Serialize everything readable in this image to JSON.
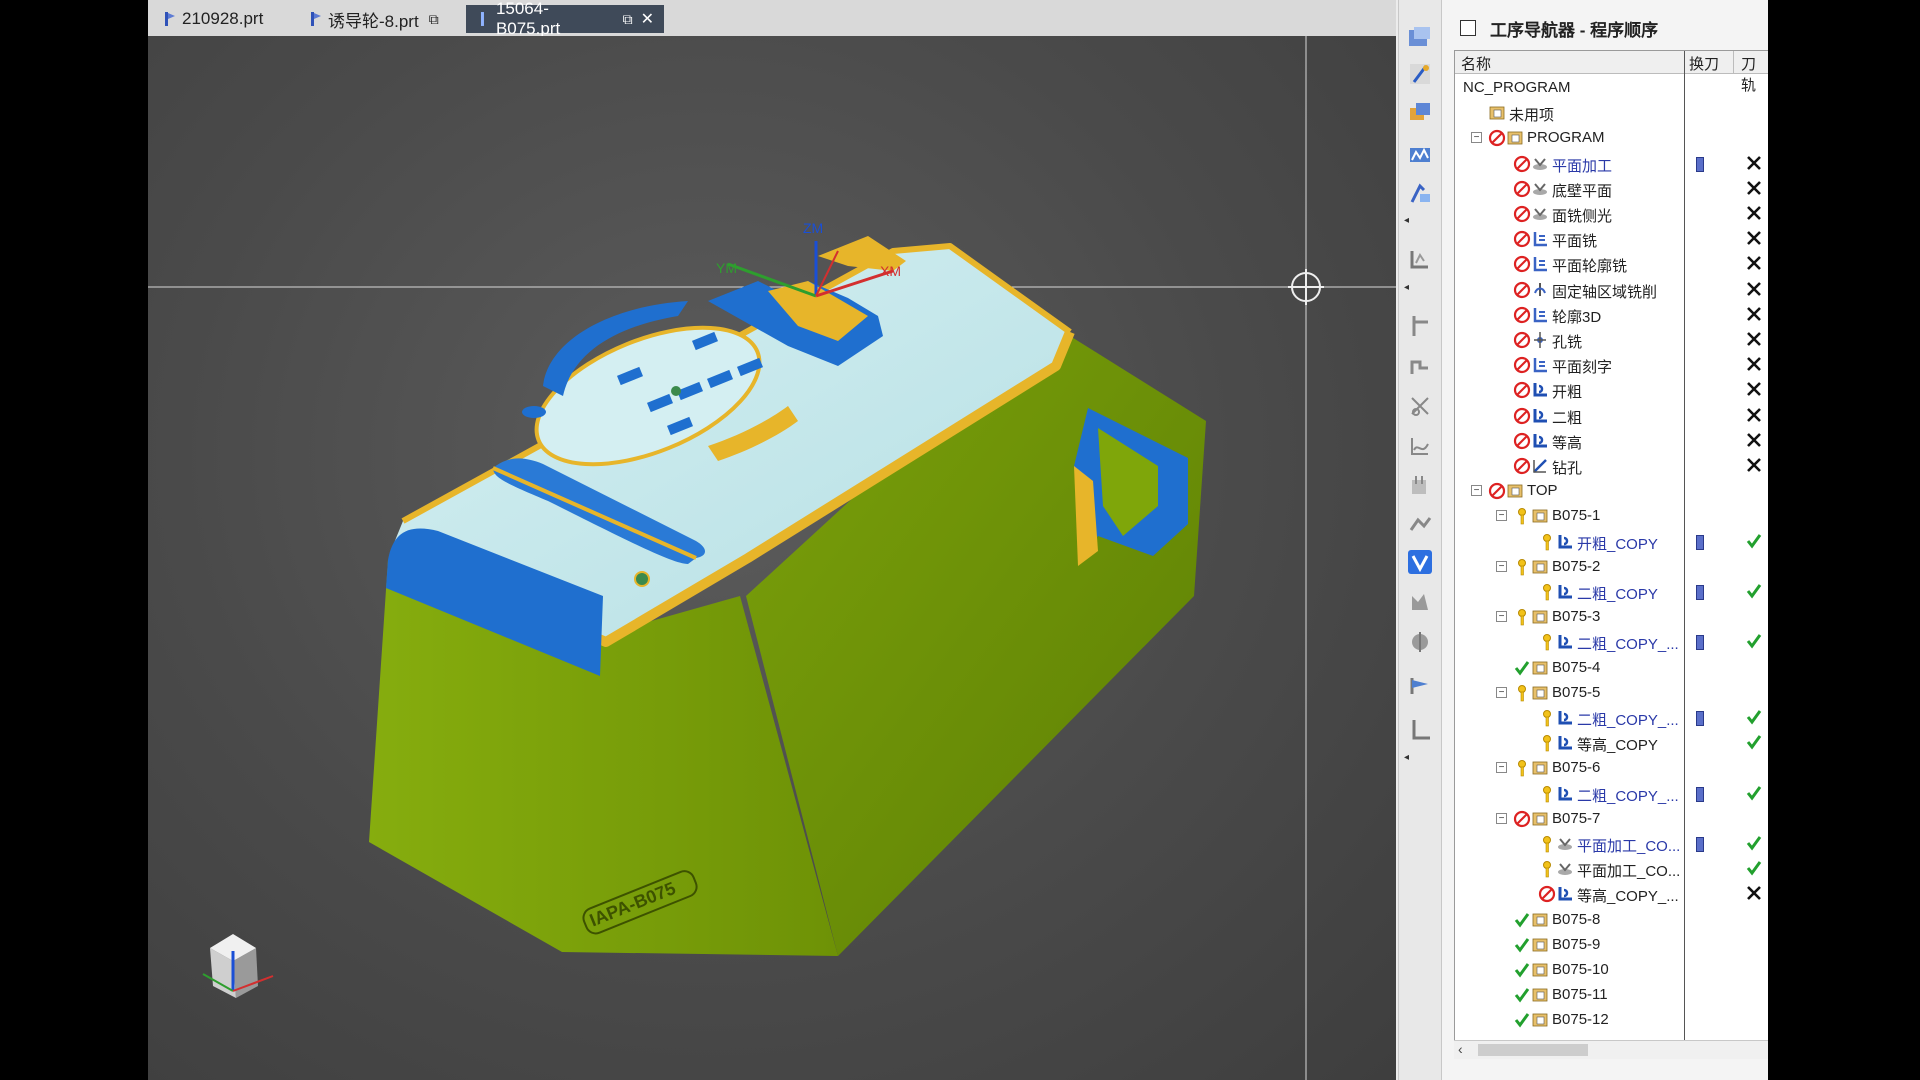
{
  "tabs": [
    {
      "label": "210928.prt",
      "active": false
    },
    {
      "label": "诱导轮-8.prt",
      "active": false
    },
    {
      "label": "15064-B075.prt",
      "active": true
    }
  ],
  "viewport": {
    "axis_labels": {
      "zm": "ZM",
      "ym": "YM",
      "xm": "XM"
    },
    "part_engraving": "IAPA-B075",
    "colors": {
      "body": "#7fa60a",
      "top_face": "#c6e7ea",
      "blend": "#e7b52a",
      "pocket": "#1f6fcf",
      "background": "#4a4a4a"
    }
  },
  "navigator": {
    "title": "工序导航器 - 程序顺序",
    "columns": {
      "name": "名称",
      "tool_change": "换刀",
      "tool_path": "刀轨"
    },
    "rows": [
      {
        "indent": 0,
        "expander": "",
        "status_icon": "",
        "type_icon": "",
        "label": "NC_PROGRAM",
        "blue": false,
        "tool_change": false,
        "path": ""
      },
      {
        "indent": 1,
        "expander": "",
        "status_icon": "",
        "type_icon": "folder",
        "label": "未用项",
        "blue": false,
        "tool_change": false,
        "path": ""
      },
      {
        "indent": 1,
        "expander": "−",
        "status_icon": "ban",
        "type_icon": "folder",
        "label": "PROGRAM",
        "blue": false,
        "tool_change": false,
        "path": ""
      },
      {
        "indent": 2,
        "expander": "",
        "status_icon": "ban",
        "type_icon": "face-mill",
        "label": "平面加工",
        "blue": true,
        "tool_change": true,
        "path": "cross"
      },
      {
        "indent": 2,
        "expander": "",
        "status_icon": "ban",
        "type_icon": "face-mill",
        "label": "底壁平面",
        "blue": false,
        "tool_change": false,
        "path": "cross"
      },
      {
        "indent": 2,
        "expander": "",
        "status_icon": "ban",
        "type_icon": "face-mill",
        "label": "面铣侧光",
        "blue": false,
        "tool_change": false,
        "path": "cross"
      },
      {
        "indent": 2,
        "expander": "",
        "status_icon": "ban",
        "type_icon": "planar",
        "label": "平面铣",
        "blue": false,
        "tool_change": false,
        "path": "cross"
      },
      {
        "indent": 2,
        "expander": "",
        "status_icon": "ban",
        "type_icon": "planar",
        "label": "平面轮廓铣",
        "blue": false,
        "tool_change": false,
        "path": "cross"
      },
      {
        "indent": 2,
        "expander": "",
        "status_icon": "ban",
        "type_icon": "fixed-axis",
        "label": "固定轴区域铣削",
        "blue": false,
        "tool_change": false,
        "path": "cross"
      },
      {
        "indent": 2,
        "expander": "",
        "status_icon": "ban",
        "type_icon": "planar",
        "label": "轮廓3D",
        "blue": false,
        "tool_change": false,
        "path": "cross"
      },
      {
        "indent": 2,
        "expander": "",
        "status_icon": "ban",
        "type_icon": "hole",
        "label": "孔铣",
        "blue": false,
        "tool_change": false,
        "path": "cross"
      },
      {
        "indent": 2,
        "expander": "",
        "status_icon": "ban",
        "type_icon": "planar",
        "label": "平面刻字",
        "blue": false,
        "tool_change": false,
        "path": "cross"
      },
      {
        "indent": 2,
        "expander": "",
        "status_icon": "ban",
        "type_icon": "cavity",
        "label": "开粗",
        "blue": false,
        "tool_change": false,
        "path": "cross"
      },
      {
        "indent": 2,
        "expander": "",
        "status_icon": "ban",
        "type_icon": "cavity",
        "label": "二粗",
        "blue": false,
        "tool_change": false,
        "path": "cross"
      },
      {
        "indent": 2,
        "expander": "",
        "status_icon": "ban",
        "type_icon": "cavity",
        "label": "等高",
        "blue": false,
        "tool_change": false,
        "path": "cross"
      },
      {
        "indent": 2,
        "expander": "",
        "status_icon": "ban",
        "type_icon": "drill",
        "label": "钻孔",
        "blue": false,
        "tool_change": false,
        "path": "cross"
      },
      {
        "indent": 1,
        "expander": "−",
        "status_icon": "ban",
        "type_icon": "folder",
        "label": "TOP",
        "blue": false,
        "tool_change": false,
        "path": ""
      },
      {
        "indent": 2,
        "expander": "−",
        "status_icon": "key",
        "type_icon": "folder",
        "label": "B075-1",
        "blue": false,
        "tool_change": false,
        "path": ""
      },
      {
        "indent": 3,
        "expander": "",
        "status_icon": "key",
        "type_icon": "cavity",
        "label": "开粗_COPY",
        "blue": true,
        "tool_change": true,
        "path": "check"
      },
      {
        "indent": 2,
        "expander": "−",
        "status_icon": "key",
        "type_icon": "folder",
        "label": "B075-2",
        "blue": false,
        "tool_change": false,
        "path": ""
      },
      {
        "indent": 3,
        "expander": "",
        "status_icon": "key",
        "type_icon": "cavity",
        "label": "二粗_COPY",
        "blue": true,
        "tool_change": true,
        "path": "check"
      },
      {
        "indent": 2,
        "expander": "−",
        "status_icon": "key",
        "type_icon": "folder",
        "label": "B075-3",
        "blue": false,
        "tool_change": false,
        "path": ""
      },
      {
        "indent": 3,
        "expander": "",
        "status_icon": "key",
        "type_icon": "cavity",
        "label": "二粗_COPY_...",
        "blue": true,
        "tool_change": true,
        "path": "check"
      },
      {
        "indent": 2,
        "expander": "",
        "status_icon": "check",
        "type_icon": "folder",
        "label": "B075-4",
        "blue": false,
        "tool_change": false,
        "path": ""
      },
      {
        "indent": 2,
        "expander": "−",
        "status_icon": "key",
        "type_icon": "folder",
        "label": "B075-5",
        "blue": false,
        "tool_change": false,
        "path": ""
      },
      {
        "indent": 3,
        "expander": "",
        "status_icon": "key",
        "type_icon": "cavity",
        "label": "二粗_COPY_...",
        "blue": true,
        "tool_change": true,
        "path": "check"
      },
      {
        "indent": 3,
        "expander": "",
        "status_icon": "key",
        "type_icon": "cavity",
        "label": "等高_COPY",
        "blue": false,
        "tool_change": false,
        "path": "check"
      },
      {
        "indent": 2,
        "expander": "−",
        "status_icon": "key",
        "type_icon": "folder",
        "label": "B075-6",
        "blue": false,
        "tool_change": false,
        "path": ""
      },
      {
        "indent": 3,
        "expander": "",
        "status_icon": "key",
        "type_icon": "cavity",
        "label": "二粗_COPY_...",
        "blue": true,
        "tool_change": true,
        "path": "check"
      },
      {
        "indent": 2,
        "expander": "−",
        "status_icon": "ban",
        "type_icon": "folder",
        "label": "B075-7",
        "blue": false,
        "tool_change": false,
        "path": ""
      },
      {
        "indent": 3,
        "expander": "",
        "status_icon": "key",
        "type_icon": "face-mill",
        "label": "平面加工_CO...",
        "blue": true,
        "tool_change": true,
        "path": "check"
      },
      {
        "indent": 3,
        "expander": "",
        "status_icon": "key",
        "type_icon": "face-mill",
        "label": "平面加工_CO...",
        "blue": false,
        "tool_change": false,
        "path": "check"
      },
      {
        "indent": 3,
        "expander": "",
        "status_icon": "ban",
        "type_icon": "cavity",
        "label": "等高_COPY_...",
        "blue": false,
        "tool_change": false,
        "path": "cross"
      },
      {
        "indent": 2,
        "expander": "",
        "status_icon": "check",
        "type_icon": "folder",
        "label": "B075-8",
        "blue": false,
        "tool_change": false,
        "path": ""
      },
      {
        "indent": 2,
        "expander": "",
        "status_icon": "check",
        "type_icon": "folder",
        "label": "B075-9",
        "blue": false,
        "tool_change": false,
        "path": ""
      },
      {
        "indent": 2,
        "expander": "",
        "status_icon": "check",
        "type_icon": "folder",
        "label": "B075-10",
        "blue": false,
        "tool_change": false,
        "path": ""
      },
      {
        "indent": 2,
        "expander": "",
        "status_icon": "check",
        "type_icon": "folder",
        "label": "B075-11",
        "blue": false,
        "tool_change": false,
        "path": ""
      },
      {
        "indent": 2,
        "expander": "",
        "status_icon": "check",
        "type_icon": "folder",
        "label": "B075-12",
        "blue": false,
        "tool_change": false,
        "path": ""
      }
    ]
  }
}
